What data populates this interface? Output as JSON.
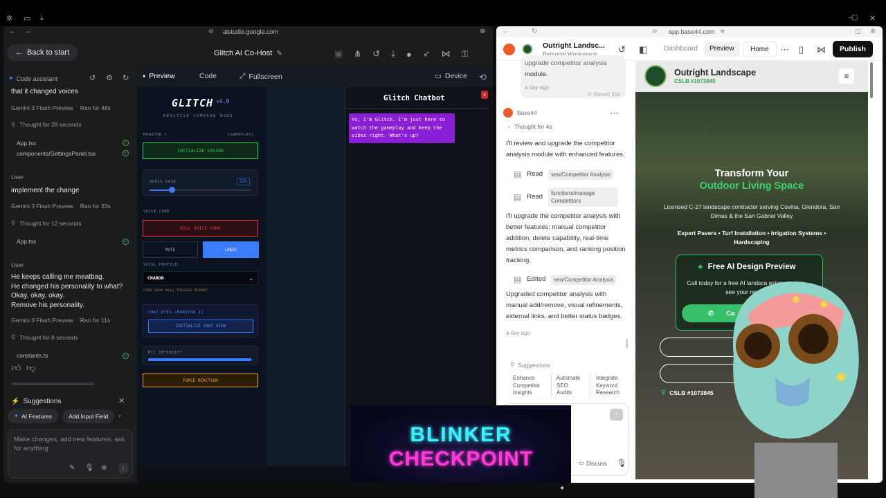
{
  "left": {
    "address": "aistudio.google.com",
    "back_label": "Back to start",
    "app_title": "Glitch AI Co-Host",
    "sidebar_header": "Code assistant",
    "messages": [
      {
        "kind": "text",
        "text": "that it changed voices"
      },
      {
        "kind": "meta",
        "model": "Gemini 3 Flash Preview",
        "ran": "Ran for 48s"
      },
      {
        "kind": "thought",
        "text": "Thought for 28 seconds"
      },
      {
        "kind": "file",
        "name": "App.tsx"
      },
      {
        "kind": "file",
        "name": "components/SettingsPanel.tsx"
      },
      {
        "kind": "user",
        "label": "User"
      },
      {
        "kind": "text",
        "text": "implement the change"
      },
      {
        "kind": "meta",
        "model": "Gemini 3 Flash Preview",
        "ran": "Ran for 33s"
      },
      {
        "kind": "thought",
        "text": "Thought for 12 seconds"
      },
      {
        "kind": "file",
        "name": "App.tsx"
      },
      {
        "kind": "user",
        "label": "User"
      },
      {
        "kind": "text",
        "text": "He keeps calling me meatbag."
      },
      {
        "kind": "text",
        "text": "He changed his personality to what?"
      },
      {
        "kind": "text",
        "text": "Okay, okay, okay."
      },
      {
        "kind": "text",
        "text": "Remove his personality."
      },
      {
        "kind": "meta",
        "model": "Gemini 3 Flash Preview",
        "ran": "Ran for 11s"
      },
      {
        "kind": "thought",
        "text": "Thought for 8 seconds"
      },
      {
        "kind": "file",
        "name": "constants.ts"
      }
    ],
    "suggestions_label": "Suggestions",
    "suggestion_chips": [
      "AI Features",
      "Add Input Field"
    ],
    "input_placeholder": "Make changes, add new features, ask for anything",
    "tabs": {
      "preview": "Preview",
      "code": "Code",
      "fullscreen": "Fullscreen",
      "device": "Device"
    }
  },
  "glitch": {
    "logo": "GLITCH",
    "version": "v4.0",
    "tagline": "REACTIVE COMMAND NODE",
    "monitor_label": "MONITOR 1",
    "monitor_tag": "[GAMEPLAY]",
    "init_vision": "INITIALIZE VISION",
    "audio_gain_label": "AUDIO GAIN",
    "audio_gain_value": "22%",
    "audio_gain_fraction": 0.22,
    "voice_core_label": "VOICE CORE",
    "kill_voice": "KILL VOICE CORE",
    "mute": "MUTE",
    "logic": "LOGIC",
    "vocal_profile_label": "VOCAL PROFILE:",
    "vocal_profile_value": "CHARON",
    "core_swap_note": "CORE SWAP WILL TRIGGER REBOOT",
    "chat_eyes_label": "CHAT EYES (MONITOR 2)",
    "init_chat_view": "INITIALIZE CHAT VIEW",
    "mic_intensity_label": "MIC INTENSITY",
    "mic_intensity_fraction": 0.98,
    "force_reaction": "FORCE REACTION",
    "chat_title": "Glitch Chatbot",
    "chat_bubble": "Yo, I'm Glitch. I'm just here to watch the gameplay and keep the vibes right. What's up?"
  },
  "right": {
    "address": "app.base44.com",
    "project_name": "Outright Landsc...",
    "workspace": "Personal Workspace",
    "nav": {
      "dashboard": "Dashboard",
      "preview": "Preview",
      "home": "Home",
      "publish": "Publish"
    },
    "chat": {
      "prev_msg_top": "upgrade competitor analysis",
      "prev_msg": "module.",
      "prev_time": "a day ago",
      "revert": "Revert this",
      "author": "Base44",
      "thought": "Thought for 4s",
      "intro": "I'll review and upgrade the competitor analysis module with enhanced features.",
      "read_label": "Read",
      "read1": "seo/Competitor Analysis",
      "read2": "functions/manage Competitors",
      "plan": "I'll upgrade the competitor analysis with better features: manual competitor addition, delete capability, real-time metrics comparison, and ranking position tracking.",
      "edited_label": "Edited",
      "edited_file": "seo/Competitor Analysis",
      "summary": "Upgraded competitor analysis with manual add/remove, visual refinements, external links, and better status badges.",
      "time": "a day ago",
      "suggestions_label": "Suggestions",
      "suggestions": [
        "Enhance Competitor Insights",
        "Automate SEO Audits",
        "Integrate Keyword Research"
      ],
      "discuss": "Discuss"
    },
    "site": {
      "brand": "Outright Landscape",
      "license": "CSLB #1073845",
      "hero_line1": "Transform Your",
      "hero_line2": "Outdoor Living Space",
      "hero_sub": "Licensed C-27 landscape contractor serving Covina, Glendora, San Dimas & the San Gabriel Valley",
      "services": "Expert Pavers • Turf Installation • Irrigation Systems • Hardscaping",
      "cta_title": "Free AI Design Preview",
      "cta_text": "Call today for a free AI landsca     esign preview — see your new yard",
      "call_btn": "Ca",
      "footer_license": "CSLB #1073845"
    }
  },
  "banner": {
    "line1": "BLINKER",
    "line2": "CHECKPOINT"
  },
  "colors": {
    "publish": "#111111",
    "site_green": "#37c06a",
    "banner_cyan": "#3df0ff",
    "banner_pink": "#ff3ad8",
    "glitch_green": "#2dd34f",
    "glitch_red": "#e53935",
    "glitch_blue": "#3d7bfd",
    "glitch_orange": "#f0a020",
    "chat_purple": "#8b1fd6"
  }
}
